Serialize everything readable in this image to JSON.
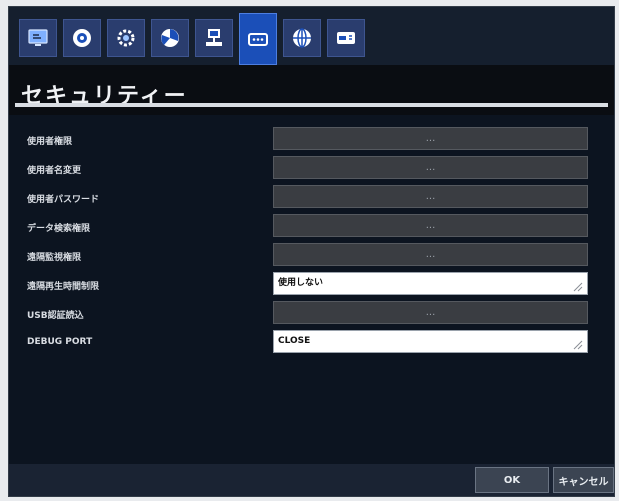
{
  "toolbar": {
    "tabs": [
      {
        "icon": "monitor-settings-icon",
        "active": false
      },
      {
        "icon": "record-disc-icon",
        "active": false
      },
      {
        "icon": "gear-icon",
        "active": false
      },
      {
        "icon": "pie-chart-icon",
        "active": false
      },
      {
        "icon": "network-computer-icon",
        "active": false
      },
      {
        "icon": "password-security-icon",
        "active": true
      },
      {
        "icon": "globe-icon",
        "active": false
      },
      {
        "icon": "device-card-icon",
        "active": false
      }
    ]
  },
  "header": {
    "title": "セキュリティー"
  },
  "settings": {
    "rows": [
      {
        "label": "使用者権限",
        "type": "button",
        "value": "..."
      },
      {
        "label": "使用者名変更",
        "type": "button",
        "value": "..."
      },
      {
        "label": "使用者パスワード",
        "type": "button",
        "value": "..."
      },
      {
        "label": "データ検索権限",
        "type": "button",
        "value": "..."
      },
      {
        "label": "遠隔監視権限",
        "type": "button",
        "value": "..."
      },
      {
        "label": "遠隔再生時間制限",
        "type": "select",
        "value": "使用しない"
      },
      {
        "label": "USB認証読込",
        "type": "button",
        "value": "..."
      },
      {
        "label": "DEBUG PORT",
        "type": "select",
        "value": "CLOSE"
      }
    ]
  },
  "footer": {
    "ok_label": "OK",
    "cancel_label": "キャンセル"
  },
  "colors": {
    "active_tab": "#1b4fb8",
    "tab": "#2a3d6e",
    "background": "#0c1420"
  }
}
